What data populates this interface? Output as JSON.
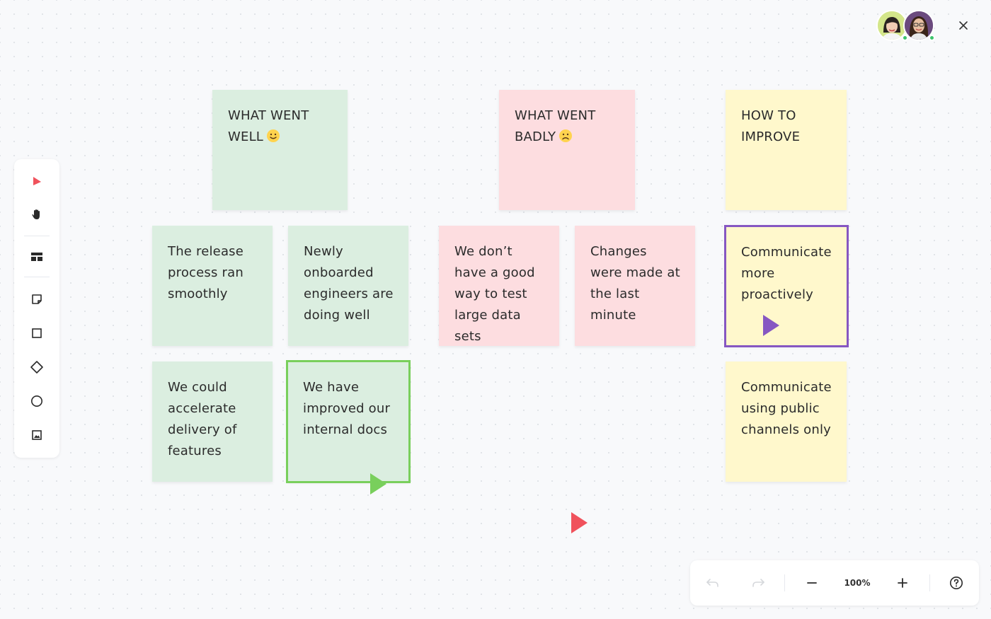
{
  "board": {
    "columns": [
      {
        "header": "WHAT WENT WELL",
        "header_emoji": "slightly-smiling-face",
        "color": "#dbeee0",
        "notes": [
          "The release process ran smoothly",
          "Newly onboarded engineers are doing well",
          "We could accelerate delivery of features",
          "We have improved our internal docs"
        ]
      },
      {
        "header": "WHAT WENT BADLY",
        "header_emoji": "slightly-frowning-face",
        "color": "#fddde0",
        "notes": [
          "We don’t have a good way to test large data sets",
          "Changes were made at the last minute"
        ]
      },
      {
        "header": "HOW TO IMPROVE",
        "color": "#fff8cc",
        "notes": [
          "Communicate more proactively",
          "Communicate using public channels only"
        ]
      }
    ],
    "cursors": [
      {
        "name": "collaborator-green",
        "color": "#79cf5c"
      },
      {
        "name": "collaborator-purple",
        "color": "#8657c2"
      },
      {
        "name": "self",
        "color": "#f0525c"
      }
    ]
  },
  "toolbar": {
    "tools": [
      "select-icon",
      "hand-icon",
      "template-icon",
      "sticky-note-icon",
      "rectangle-icon",
      "diamond-icon",
      "circle-icon",
      "image-icon"
    ],
    "active_color": "#f0525c"
  },
  "controls": {
    "zoom": "100%"
  },
  "collaborators": [
    {
      "avatar": "avatar-1",
      "status": "online"
    },
    {
      "avatar": "avatar-2",
      "status": "online"
    }
  ]
}
